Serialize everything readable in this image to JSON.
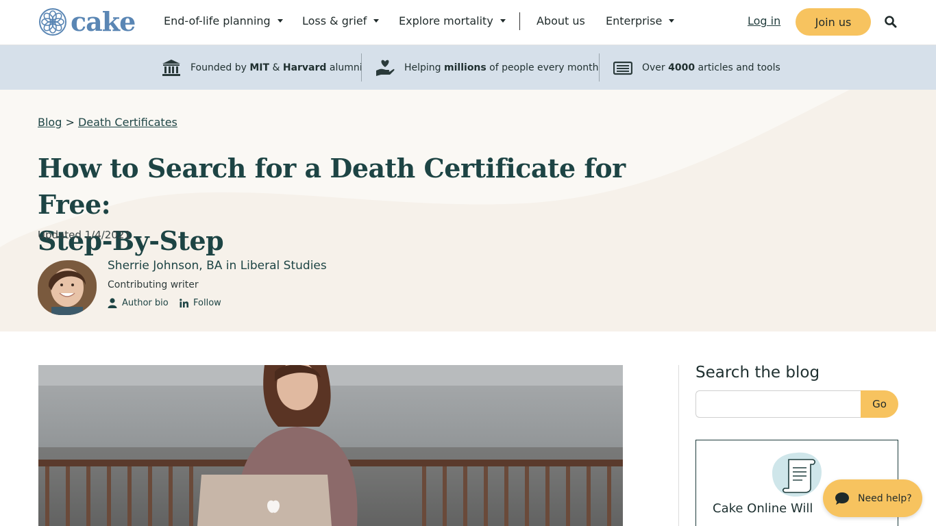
{
  "nav": {
    "logo_text": "cake",
    "items": [
      {
        "label": "End-of-life planning",
        "has_caret": true
      },
      {
        "label": "Loss & grief",
        "has_caret": true
      },
      {
        "label": "Explore mortality",
        "has_caret": true
      },
      {
        "label": "About us",
        "has_caret": false
      },
      {
        "label": "Enterprise",
        "has_caret": true
      }
    ],
    "login_label": "Log in",
    "join_label": "Join us",
    "search_icon": "search-icon"
  },
  "trust": {
    "founded": {
      "pre": "Founded by ",
      "b1": "MIT",
      "mid": " & ",
      "b2": "Harvard",
      "post": " alumni",
      "icon": "institution-icon"
    },
    "helping": {
      "pre": "Helping ",
      "b1": "millions",
      "post": " of people every month",
      "icon": "heart-hand-icon"
    },
    "articles": {
      "pre": "Over ",
      "b1": "4000",
      "post": " articles and tools",
      "icon": "newspaper-icon"
    }
  },
  "hero": {
    "breadcrumb": {
      "home": "Blog",
      "separator": " > ",
      "current": "Death Certificates"
    },
    "title_line1": "How to Search for a Death Certificate for Free:",
    "title_line2": "Step-By-Step",
    "updated": "Updated 1/4/2021",
    "author": {
      "name": "Sherrie Johnson, BA in Liberal Studies",
      "role": "Contributing writer",
      "bio_label": "Author bio",
      "follow_label": "Follow"
    }
  },
  "sidebar": {
    "search_title": "Search the blog",
    "search_placeholder": "",
    "go_label": "Go",
    "card_title": "Cake Online Will"
  },
  "help": {
    "label": "Need help?"
  },
  "colors": {
    "accent": "#f7c35f",
    "brand_blue": "#5a86b4",
    "heading": "#1d4444",
    "trust_bg": "#d6e0ea",
    "hero_bg": "#f6f1ea"
  }
}
